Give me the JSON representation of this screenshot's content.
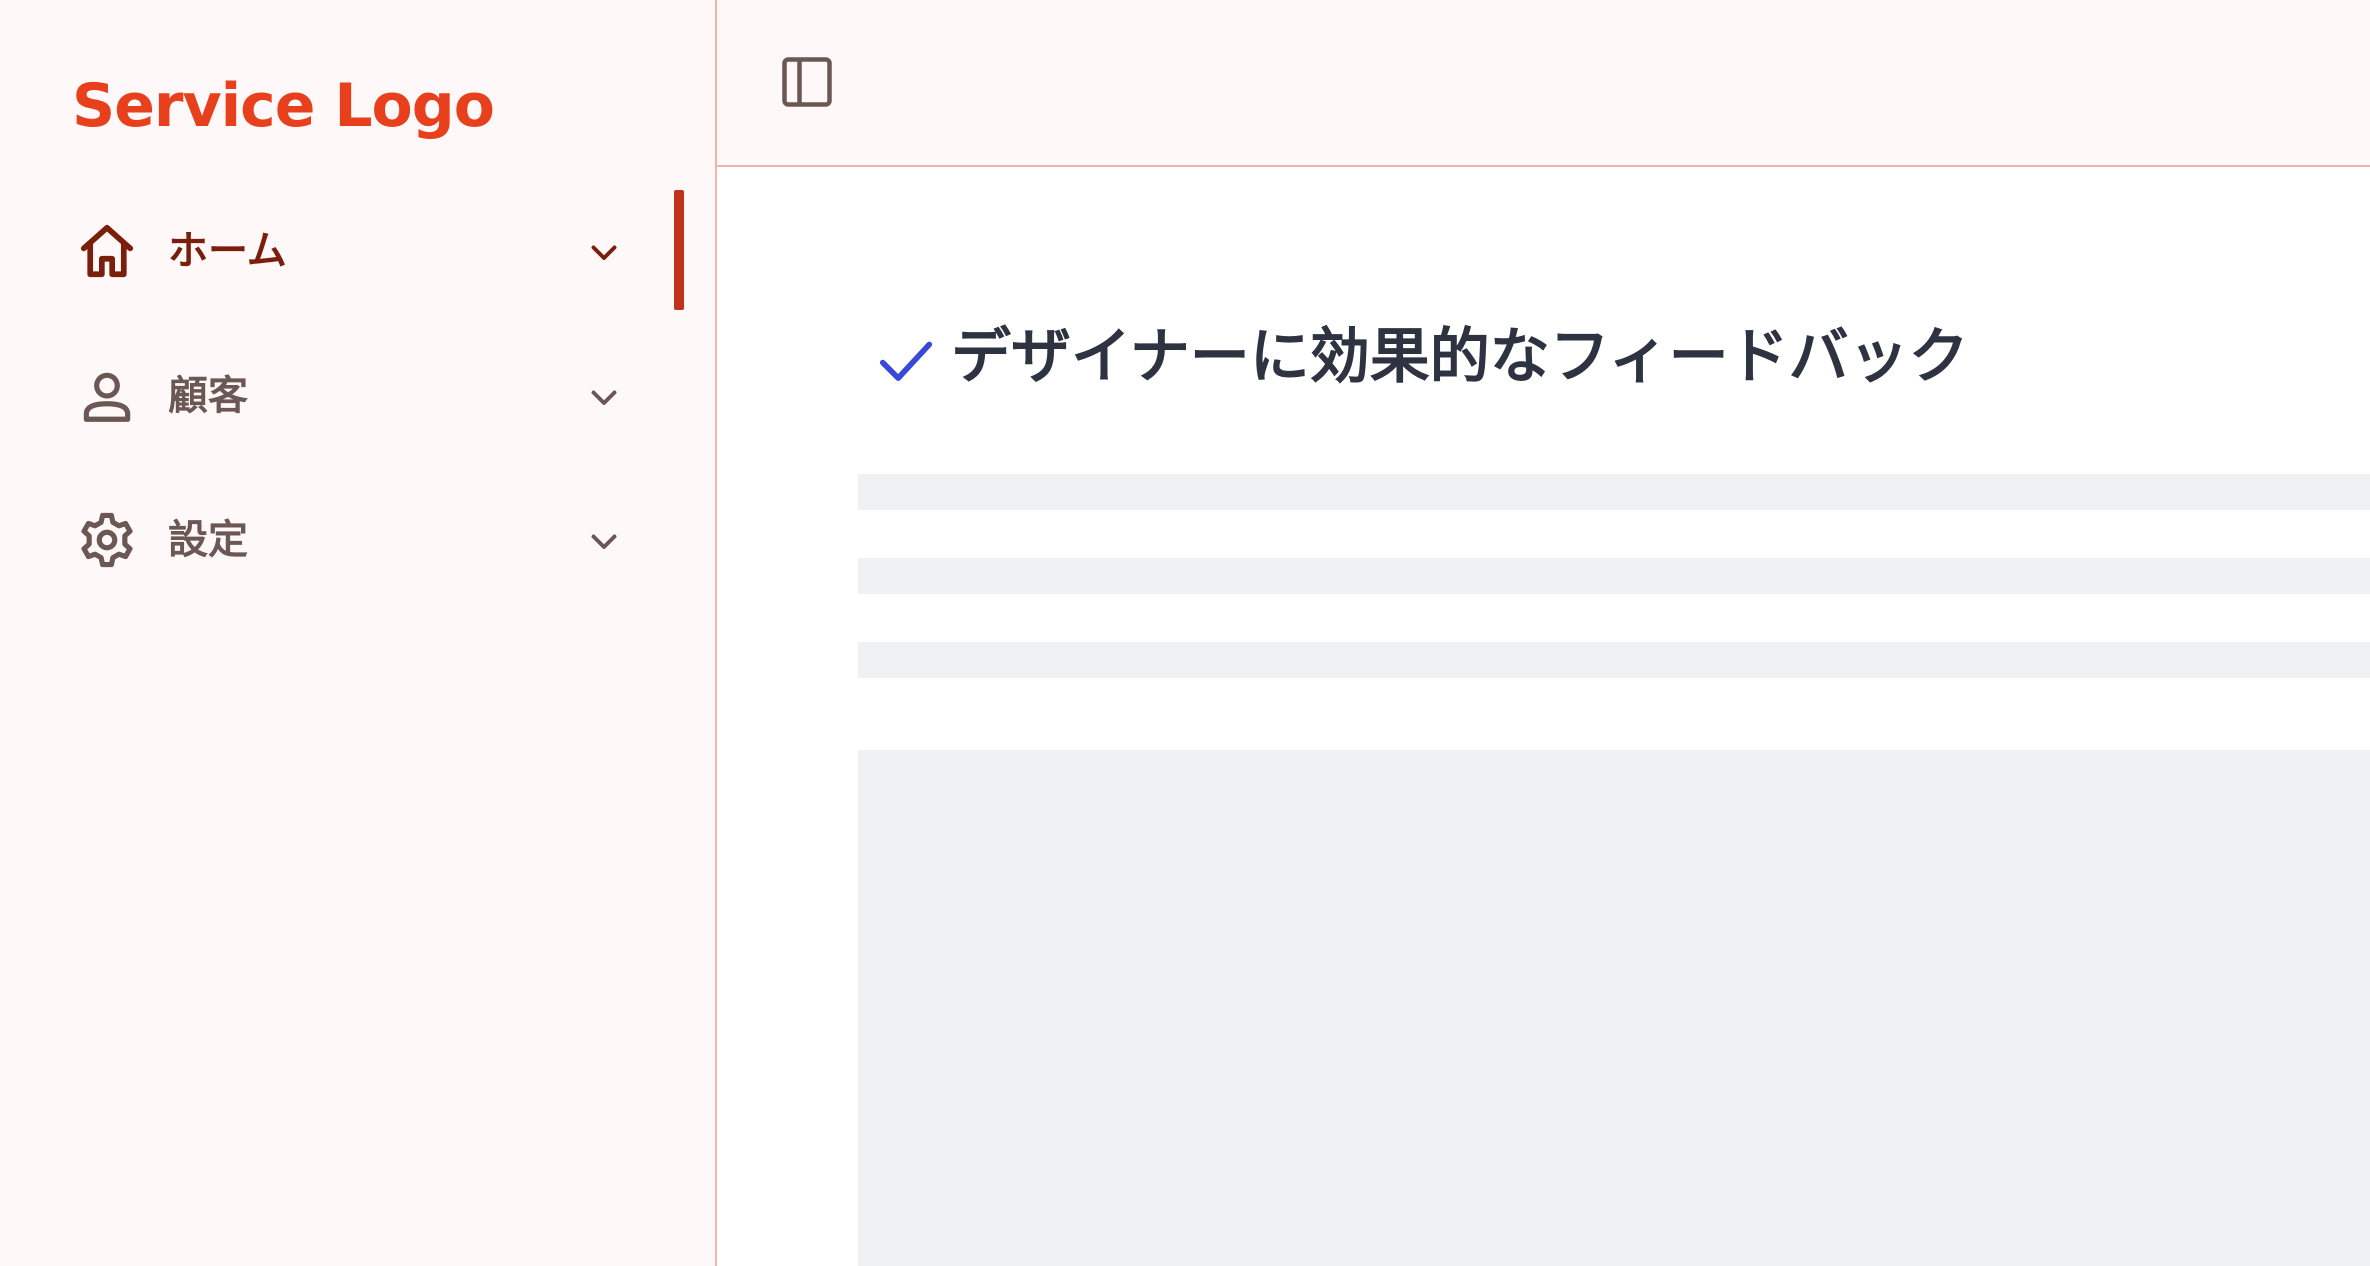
{
  "sidebar": {
    "logo": "Service Logo",
    "items": [
      {
        "label": "ホーム",
        "icon": "home-icon",
        "active": true
      },
      {
        "label": "顧客",
        "icon": "user-icon",
        "active": false
      },
      {
        "label": "設定",
        "icon": "gear-icon",
        "active": false
      }
    ]
  },
  "header": {
    "toggle_icon": "sidebar-toggle-icon"
  },
  "main": {
    "heading": "デザイナーに効果的なフィードバック",
    "heading_icon": "check-icon"
  },
  "colors": {
    "brand": "#e8401c",
    "active_text": "#7a1f0c",
    "inactive_text": "#6b5854",
    "active_indicator": "#c0321a",
    "sidebar_bg": "#fff8f8",
    "border": "#f4b3a8",
    "heading_text": "#2d3340",
    "check": "#3848d8",
    "skeleton": "#f0f1f3"
  }
}
